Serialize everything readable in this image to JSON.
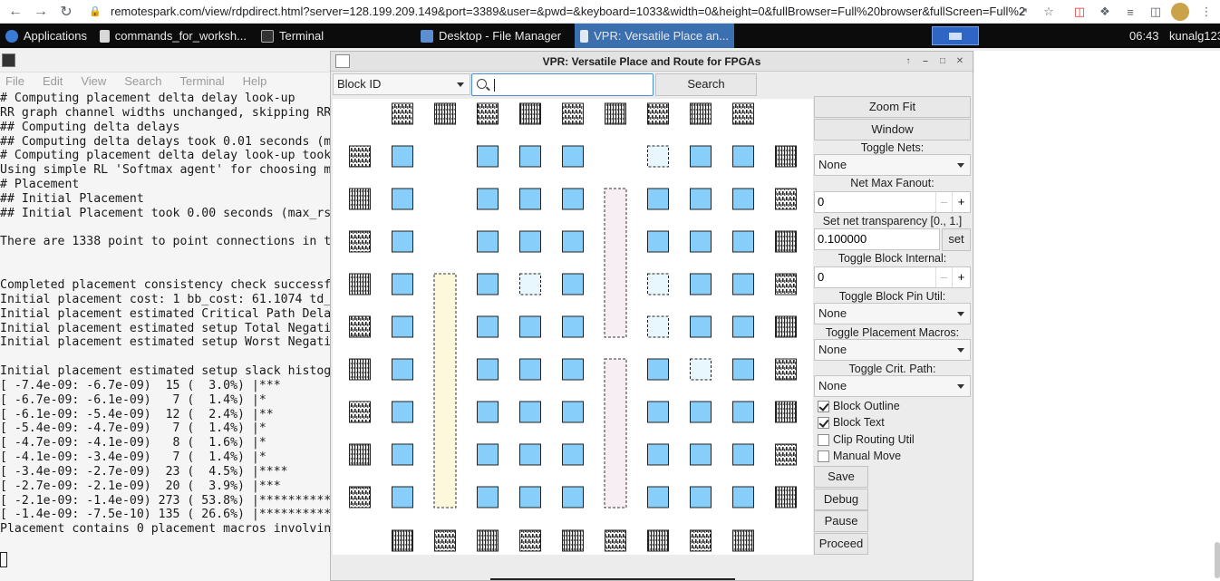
{
  "browser": {
    "url": "remotespark.com/view/rdpdirect.html?server=128.199.209.149&port=3389&user=&pwd=&keyboard=1033&width=0&height=0&fullBrowser=Full%20browser&fullScreen=Full%2..."
  },
  "panel": {
    "applications": "Applications",
    "tasks": [
      "commands_for_worksh...",
      "Terminal",
      "Desktop - File Manager",
      "VPR: Versatile Place an..."
    ],
    "clock": "06:43",
    "user": "kunalg123"
  },
  "terminal": {
    "menu": [
      "File",
      "Edit",
      "View",
      "Search",
      "Terminal",
      "Help"
    ],
    "lines": [
      "# Computing placement delta delay look-up",
      "RR graph channel widths unchanged, skipping RR",
      "## Computing delta delays",
      "## Computing delta delays took 0.01 seconds (m",
      "# Computing placement delta delay look-up took",
      "Using simple RL 'Softmax agent' for choosing m",
      "# Placement",
      "## Initial Placement",
      "## Initial Placement took 0.00 seconds (max_rs",
      "",
      "There are 1338 point to point connections in t",
      "",
      "",
      "Completed placement consistency check successf",
      "Initial placement cost: 1 bb_cost: 61.1074 td_",
      "Initial placement estimated Critical Path Dela",
      "Initial placement estimated setup Total Negati",
      "Initial placement estimated setup Worst Negati",
      "",
      "Initial placement estimated setup slack histog",
      "[ -7.4e-09: -6.7e-09)  15 (  3.0%) |***",
      "[ -6.7e-09: -6.1e-09)   7 (  1.4%) |*",
      "[ -6.1e-09: -5.4e-09)  12 (  2.4%) |**",
      "[ -5.4e-09: -4.7e-09)   7 (  1.4%) |*",
      "[ -4.7e-09: -4.1e-09)   8 (  1.6%) |*",
      "[ -4.1e-09: -3.4e-09)   7 (  1.4%) |*",
      "[ -3.4e-09: -2.7e-09)  23 (  4.5%) |****",
      "[ -2.7e-09: -2.1e-09)  20 (  3.9%) |***",
      "[ -2.1e-09: -1.4e-09) 273 ( 53.8%) |**********",
      "[ -1.4e-09: -7.5e-10) 135 ( 26.6%) |**********",
      "Placement contains 0 placement macros involvin"
    ]
  },
  "vpr": {
    "title": "VPR: Versatile Place and Route for FPGAs",
    "search_type": "Block ID",
    "search_value": "",
    "search_button": "Search",
    "zoom_fit": "Zoom Fit",
    "window": "Window",
    "toggle_nets_label": "Toggle Nets:",
    "toggle_nets_value": "None",
    "net_max_fanout_label": "Net Max Fanout:",
    "net_max_fanout_value": "0",
    "transparency_label": "Set net transparency [0., 1.]",
    "transparency_value": "0.100000",
    "transparency_set": "set",
    "block_internal_label": "Toggle Block Internal:",
    "block_internal_value": "0",
    "block_pin_util_label": "Toggle Block Pin Util:",
    "block_pin_util_value": "None",
    "placement_macros_label": "Toggle Placement Macros:",
    "placement_macros_value": "None",
    "crit_path_label": "Toggle Crit. Path:",
    "crit_path_value": "None",
    "checkboxes": [
      {
        "label": "Block Outline",
        "checked": true
      },
      {
        "label": "Block Text",
        "checked": true
      },
      {
        "label": "Clip Routing Util",
        "checked": false
      },
      {
        "label": "Manual Move",
        "checked": false
      }
    ],
    "save": "Save",
    "debug": "Debug",
    "pause": "Pause",
    "proceed": "Proceed",
    "colors": {
      "clb": "#87cefa",
      "clb_empty": "#e8f6fd",
      "mem": "#fdf8dc",
      "dsp": "#f7eef4"
    }
  }
}
